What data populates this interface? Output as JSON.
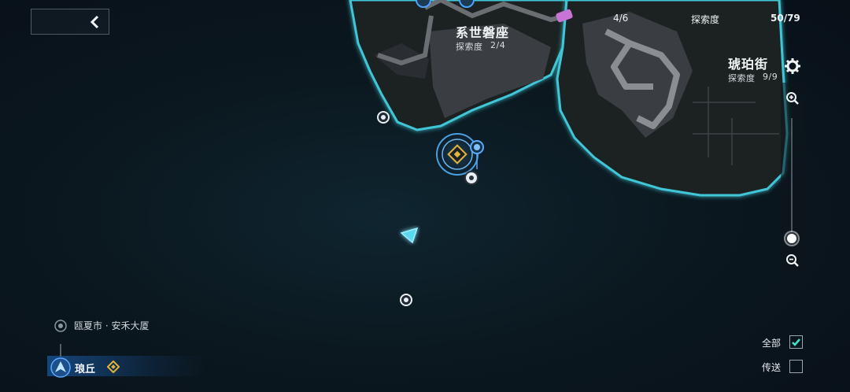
{
  "hud": {
    "back_icon": "chevron-left-icon",
    "region_progress_left": "4/6",
    "exploration_label": "探索度",
    "exploration_total": "50/79"
  },
  "regions": [
    {
      "name": "系世磐座",
      "progress_label": "探索度",
      "progress_value": "2/4"
    },
    {
      "name": "琥珀街",
      "progress_label": "探索度",
      "progress_value": "9/9"
    }
  ],
  "zoom": {
    "settings_icon": "gear-icon",
    "zoom_in_icon": "zoom-in-icon",
    "zoom_out_icon": "zoom-out-icon",
    "level": 0.1
  },
  "location": {
    "parent": "瓯夏市 · 安禾大厦",
    "current": "琅丘"
  },
  "filters": [
    {
      "label": "全部",
      "checked": true
    },
    {
      "label": "传送",
      "checked": false
    }
  ],
  "colors": {
    "accent": "#3fc6d6",
    "highlight": "#5aa8ff",
    "objective": "#e3b53a"
  }
}
